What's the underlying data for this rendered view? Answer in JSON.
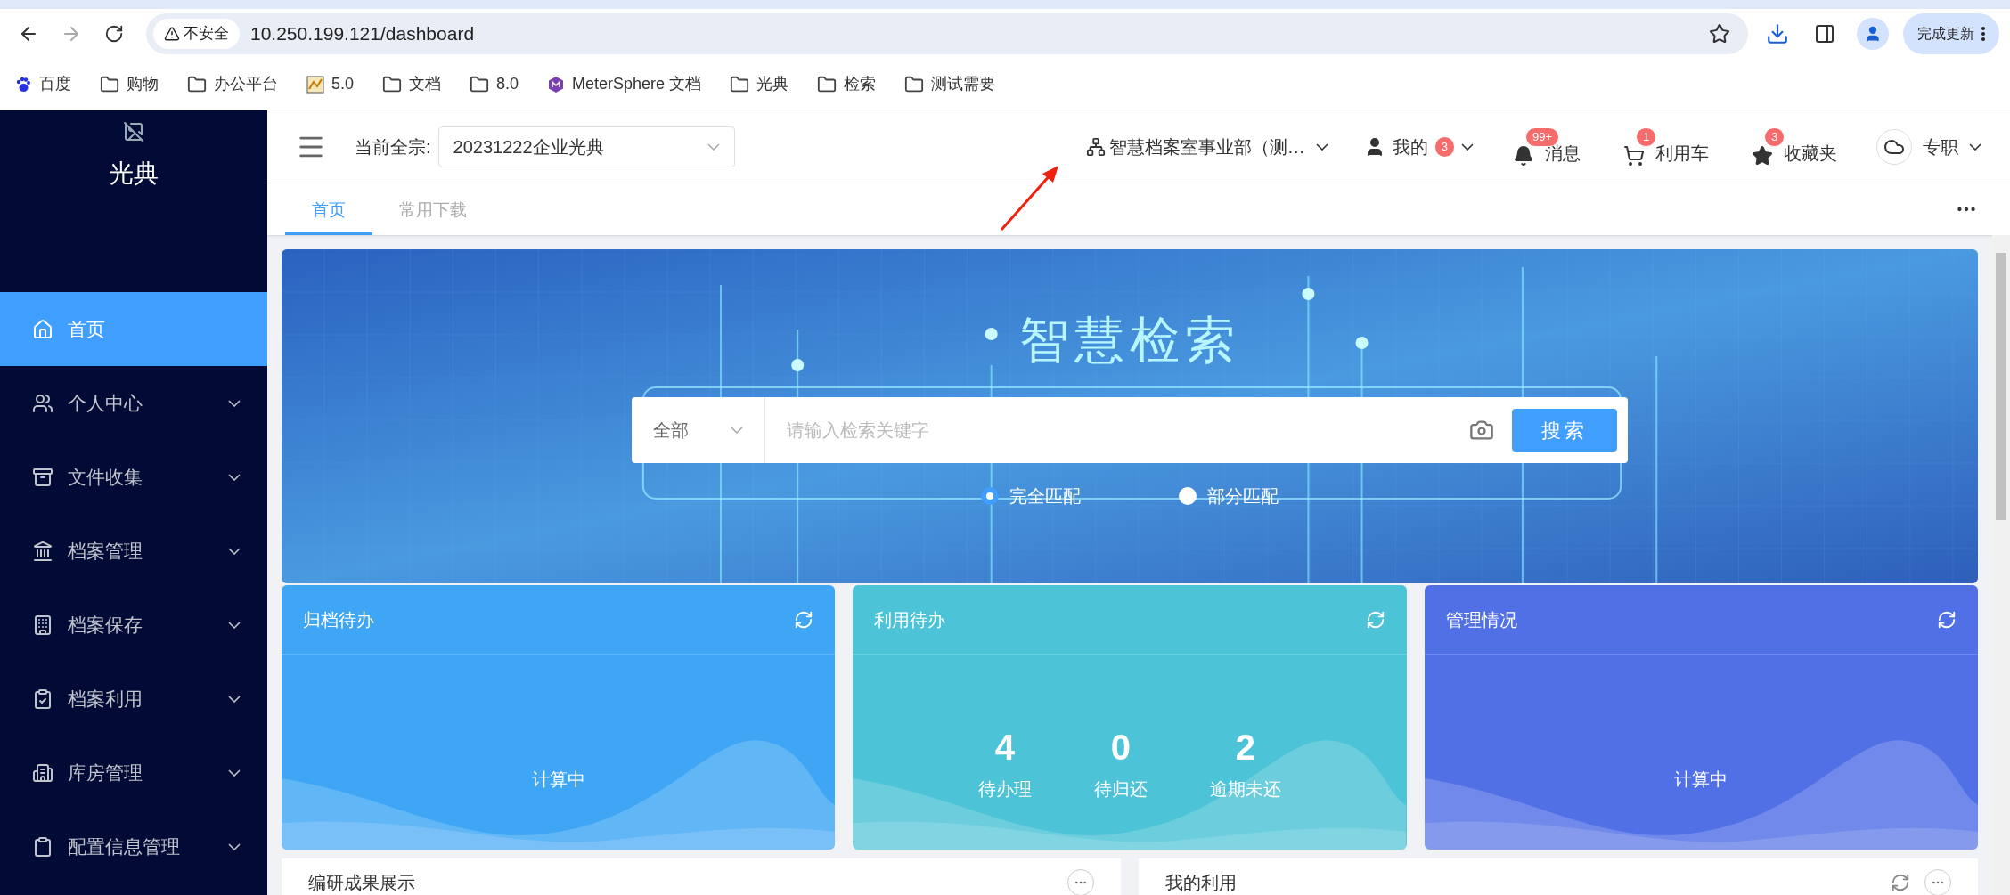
{
  "browser": {
    "security": "不安全",
    "url": "10.250.199.121/dashboard",
    "update_button": "完成更新"
  },
  "bookmarks": [
    {
      "kind": "favicon",
      "label": "百度"
    },
    {
      "kind": "folder",
      "label": "购物"
    },
    {
      "kind": "folder",
      "label": "办公平台"
    },
    {
      "kind": "favicon",
      "label": "5.0"
    },
    {
      "kind": "folder",
      "label": "文档"
    },
    {
      "kind": "folder",
      "label": "8.0"
    },
    {
      "kind": "favicon",
      "label": "MeterSphere 文档"
    },
    {
      "kind": "folder",
      "label": "光典"
    },
    {
      "kind": "folder",
      "label": "检索"
    },
    {
      "kind": "folder",
      "label": "测试需要"
    }
  ],
  "sidebar": {
    "title": "光典",
    "items": [
      {
        "label": "首页",
        "selected": true,
        "has_submenu": false
      },
      {
        "label": "个人中心",
        "selected": false,
        "has_submenu": true
      },
      {
        "label": "文件收集",
        "selected": false,
        "has_submenu": true
      },
      {
        "label": "档案管理",
        "selected": false,
        "has_submenu": true
      },
      {
        "label": "档案保存",
        "selected": false,
        "has_submenu": true
      },
      {
        "label": "档案利用",
        "selected": false,
        "has_submenu": true
      },
      {
        "label": "库房管理",
        "selected": false,
        "has_submenu": true
      },
      {
        "label": "配置信息管理",
        "selected": false,
        "has_submenu": true
      }
    ]
  },
  "header": {
    "fonds_label": "当前全宗:",
    "fonds_value": "20231222企业光典",
    "org": "智慧档案室事业部（测…",
    "user": {
      "label": "我的",
      "badge": "3"
    },
    "actions": [
      {
        "label": "消息",
        "badge": "99+"
      },
      {
        "label": "利用车",
        "badge": "1"
      },
      {
        "label": "收藏夹",
        "badge": "3"
      }
    ],
    "role": "专职"
  },
  "tabs": [
    {
      "label": "首页",
      "selected": true
    },
    {
      "label": "常用下载",
      "selected": false
    }
  ],
  "banner": {
    "title": "智慧检索",
    "scope": "全部",
    "placeholder": "请输入检索关键字",
    "search_button": "搜索",
    "match_options": [
      {
        "label": "完全匹配",
        "selected": true
      },
      {
        "label": "部分匹配",
        "selected": false
      }
    ]
  },
  "cards": [
    {
      "title": "归档待办",
      "kind": "loading",
      "color": "#3fa6f5",
      "status": "计算中"
    },
    {
      "title": "利用待办",
      "kind": "stats",
      "color": "#4cc3d6",
      "stats": [
        {
          "value": "4",
          "label": "待办理"
        },
        {
          "value": "0",
          "label": "待归还"
        },
        {
          "value": "2",
          "label": "逾期未还"
        }
      ]
    },
    {
      "title": "管理情况",
      "kind": "loading",
      "color": "#5170e6",
      "status": "计算中"
    }
  ],
  "panels": [
    {
      "title": "编研成果展示",
      "refresh": false
    },
    {
      "title": "我的利用",
      "refresh": true
    }
  ]
}
